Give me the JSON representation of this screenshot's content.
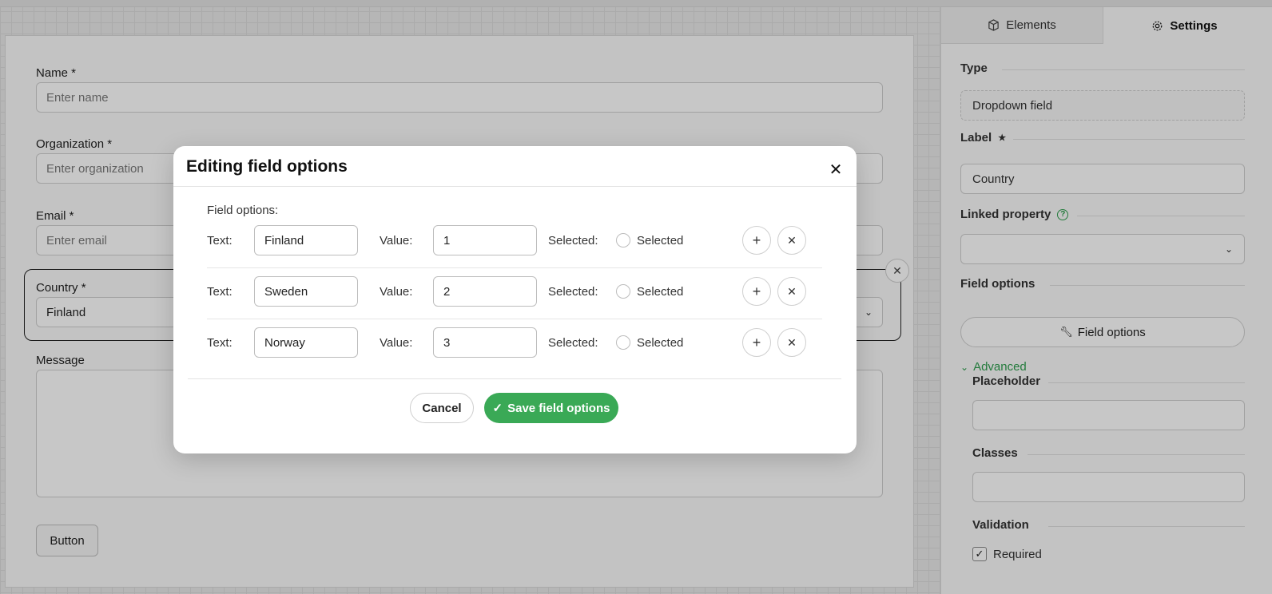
{
  "form": {
    "name_label": "Name *",
    "name_placeholder": "Enter name",
    "organization_label": "Organization *",
    "organization_placeholder": "Enter organization",
    "email_label": "Email *",
    "email_placeholder": "Enter email",
    "country_label": "Country *",
    "country_value": "Finland",
    "message_label": "Message",
    "button_label": "Button"
  },
  "sidebar": {
    "tabs": [
      "Elements",
      "Settings"
    ],
    "type_label": "Type",
    "type_value": "Dropdown field",
    "label_label": "Label",
    "label_value": "Country",
    "linked_property_label": "Linked property",
    "field_options_label": "Field options",
    "field_options_button": "Field options",
    "advanced_label": "Advanced",
    "placeholder_label": "Placeholder",
    "classes_label": "Classes",
    "validation_label": "Validation",
    "required_label": "Required",
    "required_checked": true
  },
  "modal": {
    "title": "Editing field options",
    "field_options_label": "Field options:",
    "text_label": "Text:",
    "value_label": "Value:",
    "selected_label": "Selected:",
    "radio_label": "Selected",
    "options": [
      {
        "text": "Finland",
        "value": "1"
      },
      {
        "text": "Sweden",
        "value": "2"
      },
      {
        "text": "Norway",
        "value": "3"
      }
    ],
    "cancel_label": "Cancel",
    "save_label": "Save field options"
  },
  "colors": {
    "accent": "#3aa956"
  }
}
